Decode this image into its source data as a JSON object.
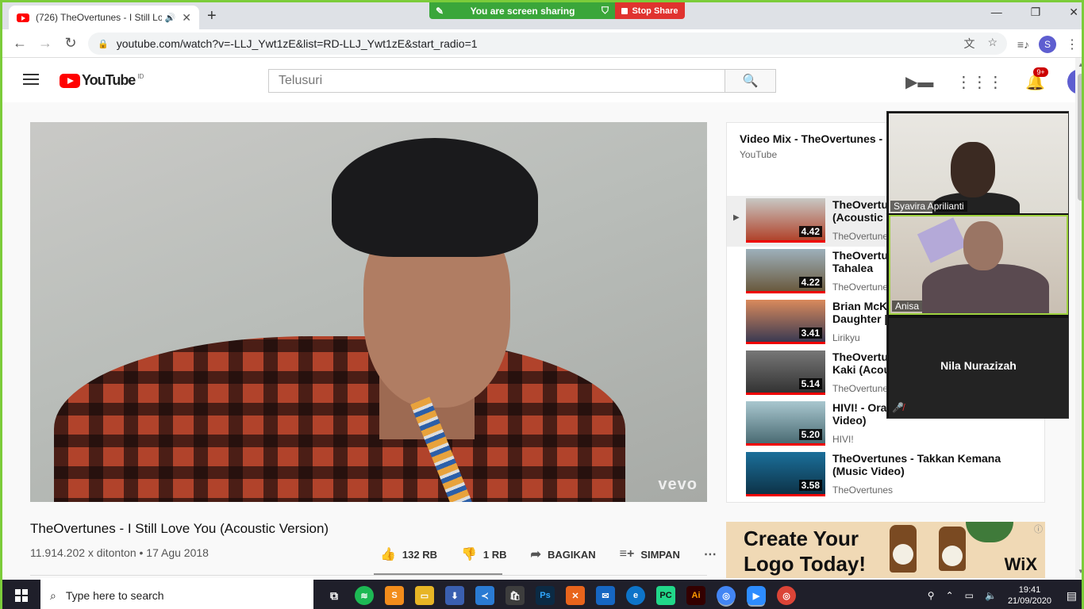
{
  "browser": {
    "tab_title": "(726) TheOvertunes - I Still Lo",
    "new_tab_label": "+",
    "url": "youtube.com/watch?v=-LLJ_Ywt1zE&list=RD-LLJ_Ywt1zE&start_radio=1",
    "profile_initial": "S"
  },
  "screen_share": {
    "status": "You are screen sharing",
    "stop_label": "Stop Share"
  },
  "youtube": {
    "logo_text": "YouTube",
    "region": "ID",
    "search_placeholder": "Telusuri",
    "notification_count": "9+",
    "avatar_initial": "S"
  },
  "video": {
    "title": "TheOvertunes - I Still Love You (Acoustic Version)",
    "views_date": "11.914.202 x ditonton • 17 Agu 2018",
    "watermark": "vevo",
    "likes": "132 RB",
    "dislikes": "1 RB",
    "share_label": "BAGIKAN",
    "save_label": "SIMPAN",
    "like_ratio": 0.99
  },
  "playlist": {
    "title": "Video Mix - TheOvertunes - I S",
    "source": "YouTube",
    "items": [
      {
        "title": "TheOvertun\n(Acoustic V",
        "channel": "TheOvertune",
        "duration": "4.42",
        "colors": [
          "#c8c8c4",
          "#b1432b"
        ]
      },
      {
        "title": "TheOvertun\nTahalea",
        "channel": "TheOvertune",
        "duration": "4.22",
        "colors": [
          "#9db0bb",
          "#6a5a3e"
        ]
      },
      {
        "title": "Brian McKn\nDaughter |",
        "channel": "Lirikyu",
        "duration": "3.41",
        "colors": [
          "#d98a5c",
          "#3a3a52"
        ]
      },
      {
        "title": "TheOvertun\nKaki (Acou",
        "channel": "TheOvertune",
        "duration": "5.14",
        "colors": [
          "#777",
          "#333"
        ]
      },
      {
        "title": "HIVI! - Oran\nVideo)",
        "channel": "HIVI!",
        "duration": "5.20",
        "colors": [
          "#a9c7cf",
          "#4a6b73"
        ]
      },
      {
        "title": "TheOvertunes - Takkan Kemana\n(Music Video)",
        "channel": "TheOvertunes",
        "duration": "3.58",
        "colors": [
          "#1b6f9a",
          "#0d3348"
        ]
      }
    ]
  },
  "ad": {
    "line1": "Create Your",
    "line2": "Logo Today!",
    "brand": "WiX"
  },
  "zoom": {
    "participants": [
      {
        "name": "Syavira Aprilianti"
      },
      {
        "name": "Anisa"
      },
      {
        "name": "Nila Nurazizah"
      }
    ]
  },
  "taskbar": {
    "search_placeholder": "Type here to search",
    "time": "19:41",
    "date": "21/09/2020"
  }
}
